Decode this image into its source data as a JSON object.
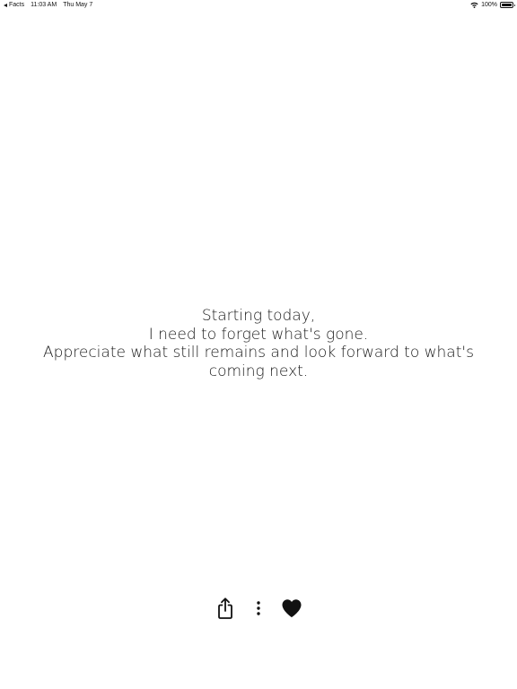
{
  "status_bar": {
    "back_app": "Facts",
    "time": "11:03 AM",
    "date": "Thu May 7",
    "battery_percent": "100%",
    "battery_level": 1.0
  },
  "quote": {
    "lines": [
      "Starting today,",
      "I need to forget what's gone.",
      "Appreciate what still remains and look forward to what's",
      "coming next."
    ]
  },
  "actions": {
    "share_icon": "share-icon",
    "more_icon": "more-vertical-icon",
    "like_icon": "heart-icon"
  }
}
